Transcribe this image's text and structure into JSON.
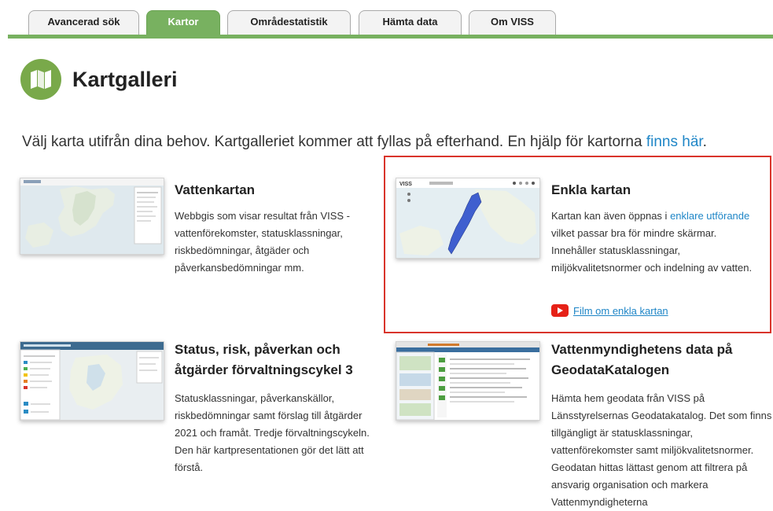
{
  "tabs": [
    {
      "label": "Avancerad sök",
      "active": false
    },
    {
      "label": "Kartor",
      "active": true
    },
    {
      "label": "Områdestatistik",
      "active": false
    },
    {
      "label": "Hämta data",
      "active": false
    },
    {
      "label": "Om VISS",
      "active": false
    }
  ],
  "page": {
    "title": "Kartgalleri",
    "intro_text": "Välj karta utifrån dina behov. Kartgalleriet kommer att fyllas på efterhand. En hjälp för kartorna ",
    "intro_link": "finns här",
    "intro_end": "."
  },
  "cards": {
    "vattenkartan": {
      "title": "Vattenkartan",
      "desc": "Webbgis som visar resultat från VISS - vattenförekomster, statusklassningar, riskbedömningar, åtgäder och påverkansbedömningar mm."
    },
    "enkla": {
      "title": "Enkla kartan",
      "desc_pre": "Kartan kan även öppnas i ",
      "desc_link": "enklare utförande",
      "desc_post": " vilket passar bra för mindre skärmar. Innehåller statusklassningar, miljökvalitetsnormer och indelning av vatten.",
      "film_link": "Film om enkla kartan"
    },
    "status": {
      "title": "Status, risk, påverkan och åtgärder förvaltningscykel 3",
      "desc": "Statusklassningar, påverkanskällor, riskbedömningar samt förslag till åtgärder 2021 och framåt. Tredje förvaltningscykeln. Den här kartpresentationen gör det lätt att förstå."
    },
    "geodata": {
      "title": "Vattenmyndighetens data på GeodataKatalogen",
      "desc": "Hämta hem geodata från VISS på Länsstyrelsernas Geodatakatalog. Det som finns tillgängligt är statusklassningar, vattenförekomster samt miljökvalitetsnormer. Geodatan hittas lättast genom att filtrera på ansvarig organisation och markera Vattenmyndigheterna"
    }
  },
  "colors": {
    "accent_green": "#78b160",
    "link_blue": "#1f86c7",
    "highlight_red": "#d9342b"
  },
  "icons": {
    "logo": "map-icon",
    "film": "youtube-play-icon"
  }
}
